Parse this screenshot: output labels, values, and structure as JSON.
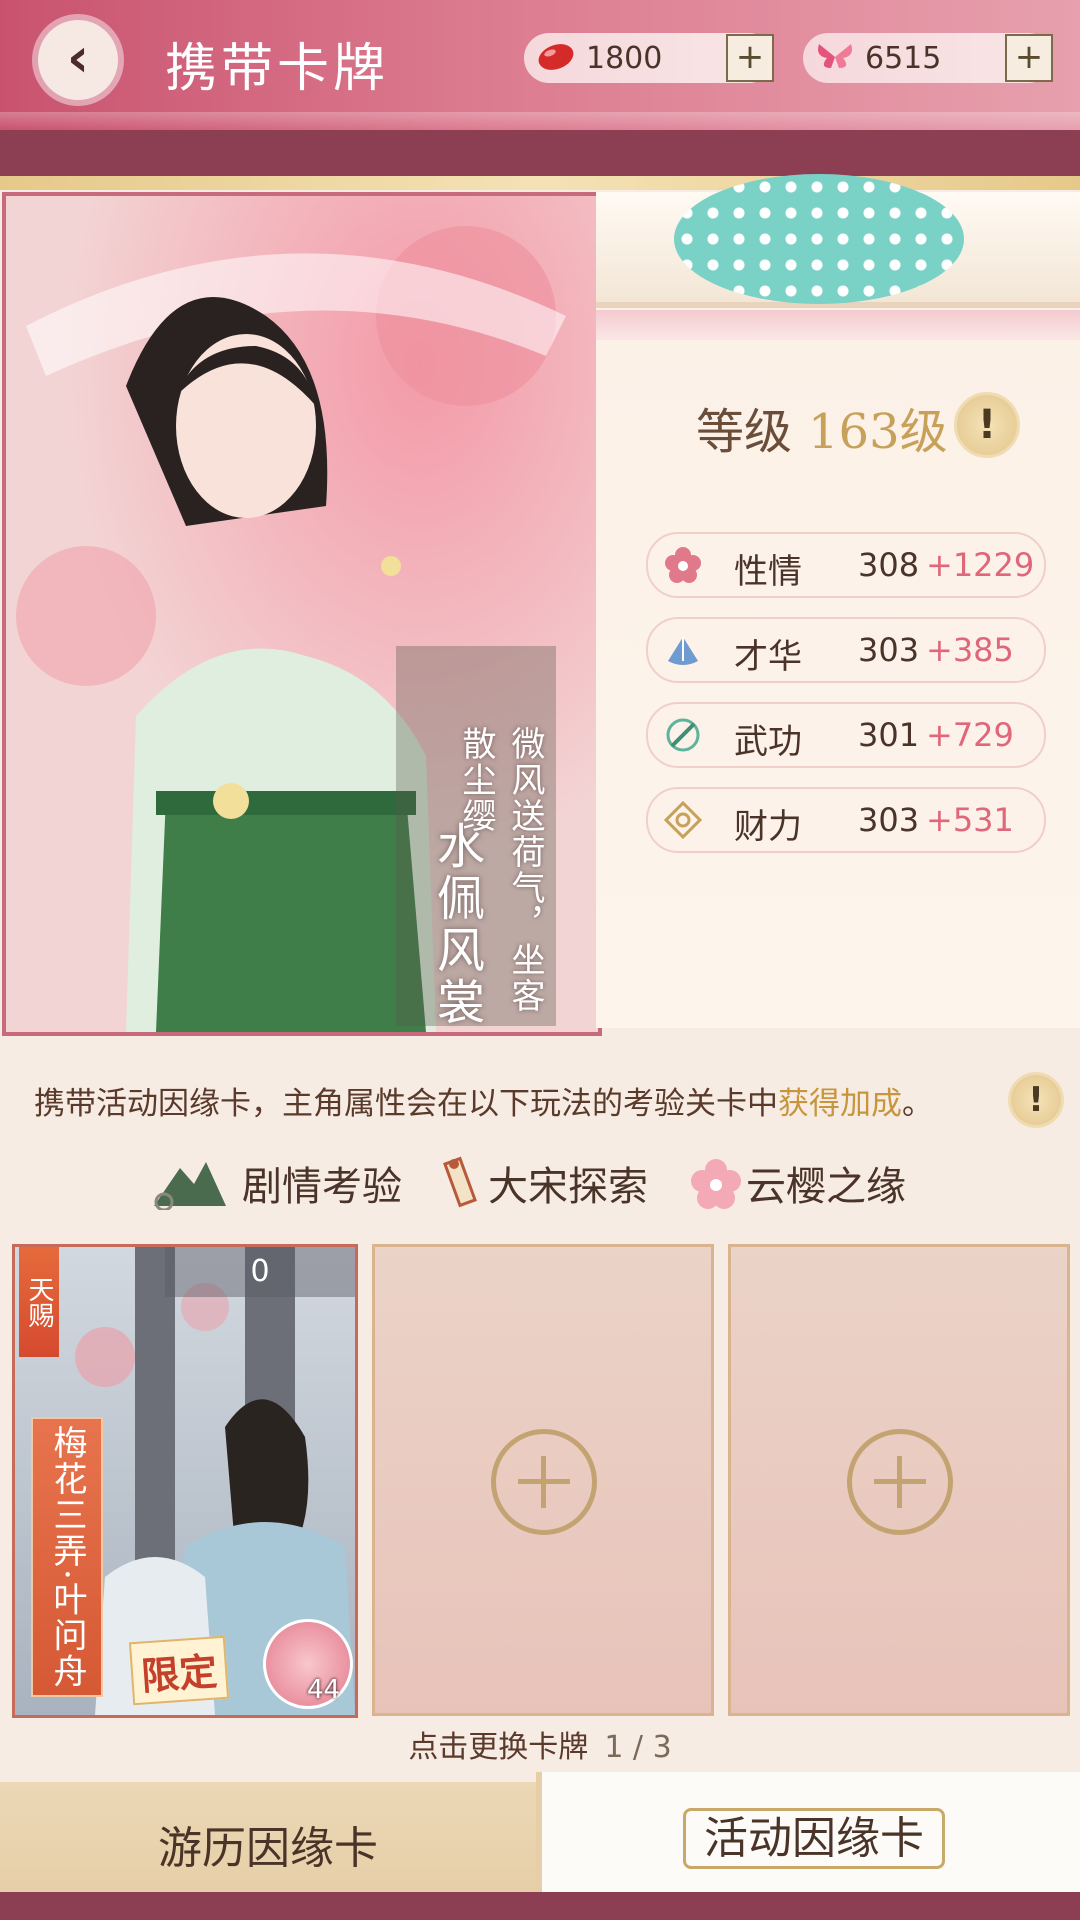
{
  "header": {
    "title": "携带卡牌",
    "back_icon": "chevron-left-icon",
    "resources": [
      {
        "icon": "red-bean-icon",
        "value": "1800",
        "add": "+"
      },
      {
        "icon": "butterfly-icon",
        "value": "6515",
        "add": "+"
      }
    ]
  },
  "card": {
    "name": "水佩风裳",
    "poem": "微风送荷气，坐客散尘缨"
  },
  "level": {
    "label": "等级",
    "value": "163级",
    "info": "!"
  },
  "stats": [
    {
      "icon": "flower-icon",
      "label": "性情",
      "base": "308",
      "bonus": "+1229"
    },
    {
      "icon": "fan-icon",
      "label": "才华",
      "base": "303",
      "bonus": "+385"
    },
    {
      "icon": "sword-icon",
      "label": "武功",
      "base": "301",
      "bonus": "+729"
    },
    {
      "icon": "coin-icon",
      "label": "财力",
      "base": "303",
      "bonus": "+531"
    }
  ],
  "description": {
    "text": "携带活动因缘卡，主角属性会在以下玩法的考验关卡中",
    "highlight": "获得加成",
    "end": "。",
    "info": "!"
  },
  "modes": [
    {
      "icon": "mountain-icon",
      "label": "剧情考验"
    },
    {
      "icon": "scroll-icon",
      "label": "大宋探索"
    },
    {
      "icon": "cherry-blossom-icon",
      "label": "云樱之缘"
    }
  ],
  "slots": {
    "filled": {
      "tag": "天赐",
      "count": "0",
      "name": "梅花三弄·叶问舟",
      "limited": "限定",
      "level": "44"
    },
    "empty_icon": "plus-circle-icon"
  },
  "switch_hint": {
    "text": "点击更换卡牌",
    "page": "1 / 3"
  },
  "tabs": [
    {
      "label": "游历因缘卡",
      "active": false
    },
    {
      "label": "活动因缘卡",
      "active": true
    }
  ],
  "colors": {
    "accent_pink": "#e0667a",
    "gold": "#c7a15a",
    "header": "#c9536f"
  }
}
